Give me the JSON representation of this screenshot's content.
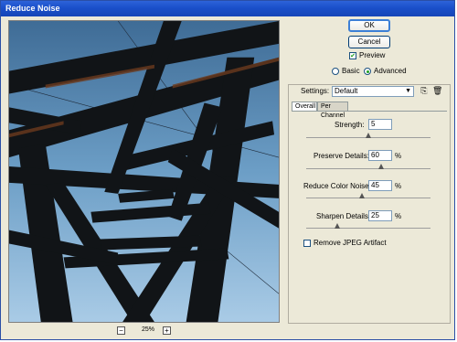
{
  "title": "Reduce Noise",
  "buttons": {
    "ok": "OK",
    "cancel": "Cancel"
  },
  "preview": {
    "label": "Preview",
    "checked": true
  },
  "mode": {
    "basic": "Basic",
    "advanced": "Advanced",
    "selected": "Advanced"
  },
  "settings": {
    "label": "Settings:",
    "value": "Default"
  },
  "tabs": [
    "Overall",
    "Per Channel"
  ],
  "fields": [
    {
      "label": "Strength:",
      "value": "5",
      "unit": "",
      "level": 0.5
    },
    {
      "label": "Preserve Details:",
      "value": "60",
      "unit": "%",
      "level": 0.6
    },
    {
      "label": "Reduce Color Noise:",
      "value": "45",
      "unit": "%",
      "level": 0.45
    },
    {
      "label": "Sharpen Details:",
      "value": "25",
      "unit": "%",
      "level": 0.25
    }
  ],
  "remove_jpeg": {
    "label": "Remove JPEG Artifact",
    "checked": false
  },
  "zoom": {
    "value": "25%",
    "minus": "−",
    "plus": "+"
  },
  "icons": {
    "save": "save-settings-icon",
    "delete": "delete-settings-icon"
  }
}
